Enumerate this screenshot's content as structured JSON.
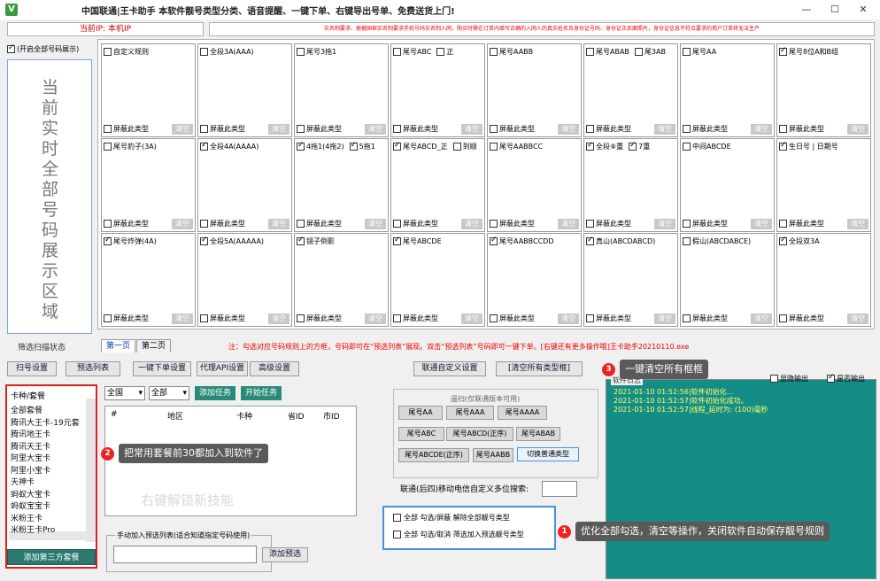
{
  "app": {
    "icon_letter": "V",
    "title": "中国联通|王卡助手   本软件靓号类型分类、语音提醒、一键下单、右键导出号单、免费送货上门!",
    "window_controls": [
      "—",
      "☐",
      "✕"
    ]
  },
  "ip_label": "当前IP: 本机IP",
  "notice": "实名制要求、根据国家实名制要求手机号码实名制入网，购买时需在订单内填写正确的入网人的真实姓名及身份证号码、身份证正反面照片，身份证信息不符合要求的用户订单将无法生产",
  "show_all_label": "(开启全部号码展示)",
  "big_display": [
    "当",
    "前",
    "实",
    "时",
    "全",
    "部",
    "号",
    "码",
    "展",
    "示",
    "区",
    "域"
  ],
  "grid": {
    "block_label": "屏蔽此类型",
    "clear_label": "清空",
    "rows": [
      [
        {
          "l": "自定义规则",
          "c": false,
          "b": false
        },
        {
          "l": "全段3A(AAA)",
          "c": false,
          "b": false
        },
        {
          "l": "尾号3拖1",
          "c": false,
          "b": false
        },
        {
          "l": "尾号ABC",
          "c": false,
          "b": false,
          "l2": "正",
          "c2": false
        },
        {
          "l": "尾号AABB",
          "c": false,
          "b": false
        },
        {
          "l": "尾号ABAB",
          "c": false,
          "b": false,
          "l2": "尾3AB",
          "c2": false
        },
        {
          "l": "尾号AA",
          "c": false,
          "b": false
        },
        {
          "l": "尾号8位A和B组",
          "c": true,
          "b": false
        }
      ],
      [
        {
          "l": "尾号豹子(3A)",
          "c": false,
          "b": false
        },
        {
          "l": "全段4A(AAAA)",
          "c": true,
          "b": false
        },
        {
          "l": "4拖1(4拖2)",
          "c": true,
          "b": false,
          "l2": "5拖1",
          "c2": true
        },
        {
          "l": "尾号ABCD_正",
          "c": true,
          "b": false,
          "l2": "到顺",
          "c2": false
        },
        {
          "l": "尾号AABBCC",
          "c": false,
          "b": false
        },
        {
          "l": "全段⑧重",
          "c": true,
          "b": false,
          "l2": "7重",
          "c2": true
        },
        {
          "l": "中间ABCDE",
          "c": false,
          "b": false
        },
        {
          "l": "生日号 | 日期号",
          "c": true,
          "b": false
        }
      ],
      [
        {
          "l": "尾号炸弹(4A)",
          "c": true,
          "b": false
        },
        {
          "l": "全段5A(AAAAA)",
          "c": true,
          "b": false
        },
        {
          "l": "镜子倒影",
          "c": true,
          "b": false
        },
        {
          "l": "尾号ABCDE",
          "c": true,
          "b": false
        },
        {
          "l": "尾号AABBCCDD",
          "c": true,
          "b": false
        },
        {
          "l": "真山(ABCDABCD)",
          "c": true,
          "b": false
        },
        {
          "l": "假山(ABCDABCE)",
          "c": false,
          "b": false
        },
        {
          "l": "全段双3A",
          "c": true,
          "b": false
        }
      ]
    ]
  },
  "section_label": "筛选扫描状态",
  "tabs": [
    "第一页",
    "第二页"
  ],
  "tab_note": "注：勾选对应号码规则上的方框，号码即可在“预选列表”展现。双击“预选列表”号码即可一键下单。[右键还有更多操作哦]王卡助手20210110.exe",
  "buttons": {
    "scan": "扫号设置",
    "preselect": "预选列表",
    "order": "一键下单设置",
    "proxy": "代理API设置",
    "advanced": "高级设置",
    "custom": "联通自定义设置",
    "clear_all": "[清空所有类型框]"
  },
  "card_panel": {
    "header": "卡种/套餐",
    "items": [
      "全部套餐",
      "腾讯大王卡-19元套",
      "腾讯地王卡",
      "腾讯天王卡",
      "阿里大宝卡",
      "阿里小宝卡",
      "天神卡",
      "蚂蚁大宝卡",
      "蚂蚁宝宝卡",
      "米粉王卡",
      "米粉王卡Pro"
    ],
    "add_button": "添加第三方套餐"
  },
  "filters": {
    "region": "全国",
    "type": "全部",
    "add_task": "添加任务",
    "start_task": "开始任务"
  },
  "list": {
    "headers": [
      "#",
      "地区",
      "卡种",
      "省ID",
      "市ID"
    ],
    "hint": "右键解锁新技能"
  },
  "manual": {
    "label": "手动加入预选列表(适合知道指定号码使用)",
    "add": "添加预选"
  },
  "china_rep": {
    "label": "遥扫(仅联通版本可用)",
    "buttons": [
      "尾号AA",
      "尾号AAA",
      "尾号AAAA",
      "尾号ABC",
      "尾号ABCD(正序)",
      "尾号ABAB",
      "尾号ABCDE(正序)",
      "尾号AABB",
      "切换普通类型"
    ]
  },
  "multi_search": "联通(后四)移动电信自定义多位搜索:",
  "options": [
    "全部 勾选/屏蔽 解除全部靓号类型",
    "全部 勾选/取消 筛选加入预选靓号类型"
  ],
  "log": {
    "label": "软件日志",
    "hide_output": "显隐输出",
    "output": "是否输出",
    "lines": [
      "2021-01-10 01:52:56|软件初始化...",
      "2021-01-10 01:52:57|软件初始化成功。",
      "2021-01-10 01:52:57|线程_延时为: (100)毫秒"
    ]
  },
  "tips": {
    "t1": {
      "n": "1",
      "text": "优化全部勾选，清空等操作，关闭软件自动保存靓号规则"
    },
    "t2": {
      "n": "2",
      "text": "把常用套餐前30都加入到软件了"
    },
    "t3": {
      "n": "3",
      "text": "一键清空所有框框"
    }
  }
}
